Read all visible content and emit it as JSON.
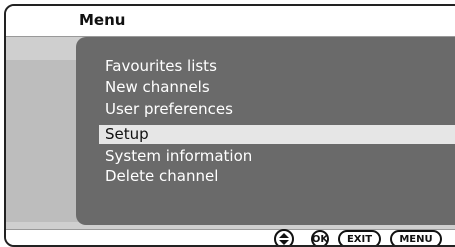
{
  "menu": {
    "title": "Menu",
    "items": [
      {
        "label": "Favourites lists",
        "selected": false
      },
      {
        "label": "New channels",
        "selected": false
      },
      {
        "label": "User preferences",
        "selected": false
      },
      {
        "label": "Setup",
        "selected": true
      },
      {
        "label": "System information",
        "selected": false
      },
      {
        "label": "Delete channel",
        "selected": false
      }
    ]
  },
  "footer": {
    "nav_icon": "up-down-arrows-icon",
    "ok_label": "OK",
    "exit_label": "EXIT",
    "menu_label": "MENU"
  },
  "colors": {
    "panel": "#6a6a6a",
    "background": "#cfcfcf",
    "highlight": "#e6e6e6",
    "text": "#ffffff"
  }
}
